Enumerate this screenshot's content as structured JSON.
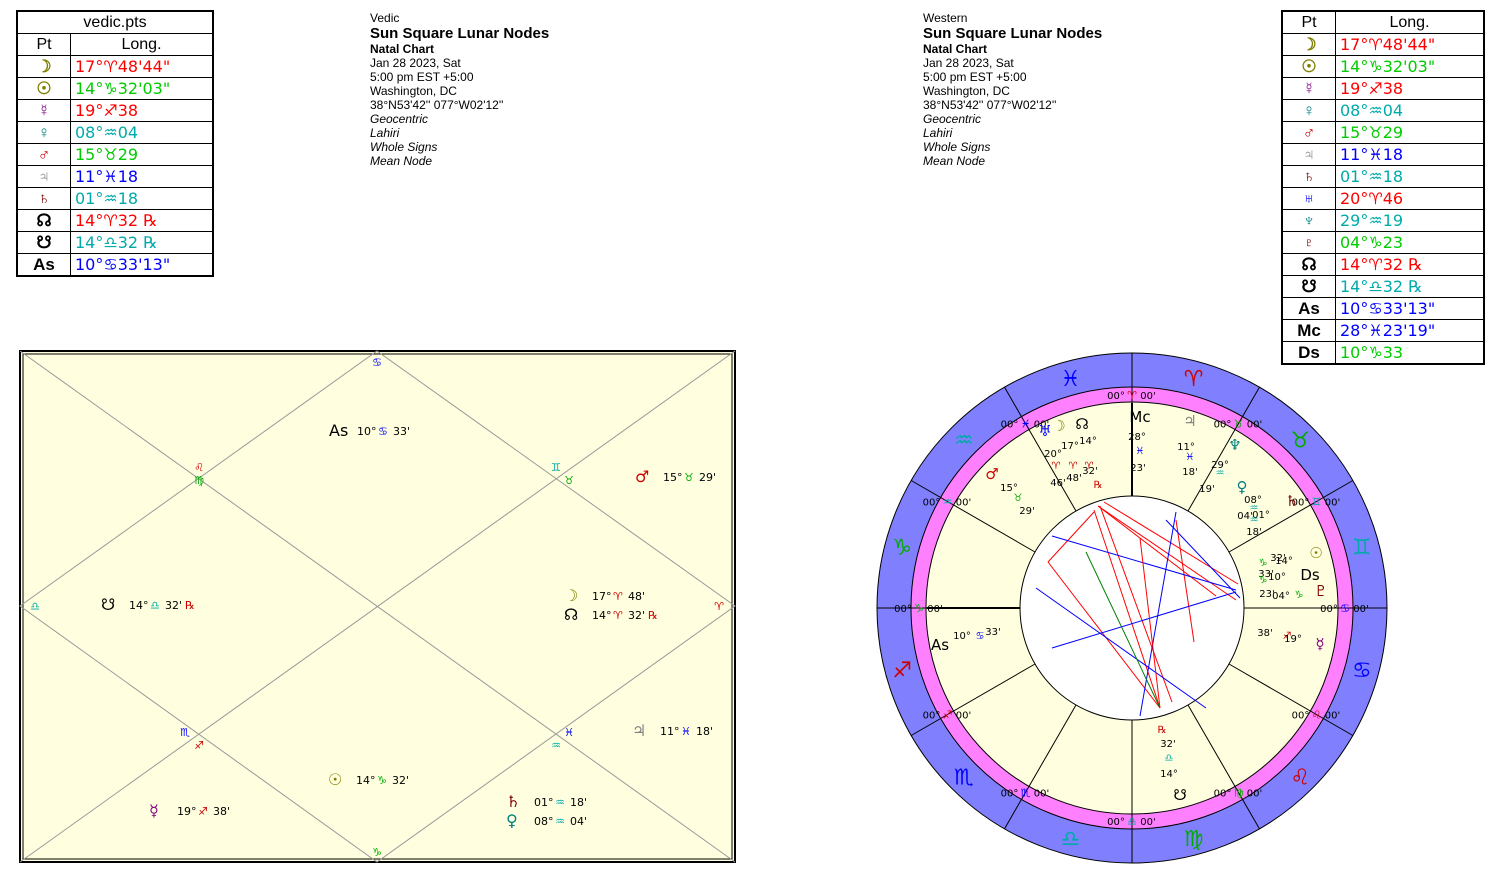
{
  "vedic_table": {
    "title": "vedic.pts",
    "col_pt": "Pt",
    "col_long": "Long.",
    "rows": [
      {
        "glyph": "☽",
        "icon": "moon-icon",
        "pos": "17°♈48'44\"",
        "color": "#ff0000",
        "gcolor": "#808000"
      },
      {
        "glyph": "☉",
        "icon": "sun-icon",
        "pos": "14°♑32'03\"",
        "color": "#00cc00",
        "gcolor": "#808000"
      },
      {
        "glyph": "☿",
        "icon": "mercury-icon",
        "pos": "19°♐38",
        "color": "#ff0000",
        "gcolor": "#800080"
      },
      {
        "glyph": "♀",
        "icon": "venus-icon",
        "pos": "08°♒04",
        "color": "#00aaaa",
        "gcolor": "#008080"
      },
      {
        "glyph": "♂",
        "icon": "mars-icon",
        "pos": "15°♉29",
        "color": "#00cc00",
        "gcolor": "#cc0000"
      },
      {
        "glyph": "♃",
        "icon": "jupiter-icon",
        "pos": "11°♓18",
        "color": "#0000ff",
        "gcolor": "#808080"
      },
      {
        "glyph": "♄",
        "icon": "saturn-icon",
        "pos": "01°♒18",
        "color": "#00aaaa",
        "gcolor": "#800000"
      },
      {
        "glyph": "☊",
        "icon": "north-node-icon",
        "pos": "14°♈32 ℞",
        "color": "#ff0000",
        "gcolor": "#000000"
      },
      {
        "glyph": "☋",
        "icon": "south-node-icon",
        "pos": "14°♎32 ℞",
        "color": "#00aaaa",
        "gcolor": "#000000"
      },
      {
        "glyph": "As",
        "icon": "ascendant-icon",
        "pos": "10°♋33'13\"",
        "color": "#0000ff",
        "gcolor": "#000000"
      }
    ]
  },
  "western_table": {
    "col_pt": "Pt",
    "col_long": "Long.",
    "rows": [
      {
        "glyph": "☽",
        "icon": "moon-icon",
        "pos": "17°♈48'44\"",
        "color": "#ff0000",
        "gcolor": "#808000"
      },
      {
        "glyph": "☉",
        "icon": "sun-icon",
        "pos": "14°♑32'03\"",
        "color": "#00cc00",
        "gcolor": "#808000"
      },
      {
        "glyph": "☿",
        "icon": "mercury-icon",
        "pos": "19°♐38",
        "color": "#ff0000",
        "gcolor": "#800080"
      },
      {
        "glyph": "♀",
        "icon": "venus-icon",
        "pos": "08°♒04",
        "color": "#00aaaa",
        "gcolor": "#008080"
      },
      {
        "glyph": "♂",
        "icon": "mars-icon",
        "pos": "15°♉29",
        "color": "#00cc00",
        "gcolor": "#cc0000"
      },
      {
        "glyph": "♃",
        "icon": "jupiter-icon",
        "pos": "11°♓18",
        "color": "#0000ff",
        "gcolor": "#808080"
      },
      {
        "glyph": "♄",
        "icon": "saturn-icon",
        "pos": "01°♒18",
        "color": "#00aaaa",
        "gcolor": "#800000"
      },
      {
        "glyph": "♅",
        "icon": "uranus-icon",
        "pos": "20°♈46",
        "color": "#ff0000",
        "gcolor": "#0000ff"
      },
      {
        "glyph": "♆",
        "icon": "neptune-icon",
        "pos": "29°♒19",
        "color": "#00aaaa",
        "gcolor": "#008080"
      },
      {
        "glyph": "♇",
        "icon": "pluto-icon",
        "pos": "04°♑23",
        "color": "#00cc00",
        "gcolor": "#800000"
      },
      {
        "glyph": "☊",
        "icon": "north-node-icon",
        "pos": "14°♈32 ℞",
        "color": "#ff0000",
        "gcolor": "#000000"
      },
      {
        "glyph": "☋",
        "icon": "south-node-icon",
        "pos": "14°♎32 ℞",
        "color": "#00aaaa",
        "gcolor": "#000000"
      },
      {
        "glyph": "As",
        "icon": "ascendant-icon",
        "pos": "10°♋33'13\"",
        "color": "#0000ff",
        "gcolor": "#000000"
      },
      {
        "glyph": "Mc",
        "icon": "midheaven-icon",
        "pos": "28°♓23'19\"",
        "color": "#0000ff",
        "gcolor": "#000000"
      },
      {
        "glyph": "Ds",
        "icon": "descendant-icon",
        "pos": "10°♑33",
        "color": "#00cc00",
        "gcolor": "#000000"
      }
    ]
  },
  "vedic_info": {
    "system": "Vedic",
    "title": "Sun Square Lunar Nodes",
    "chart_type": "Natal Chart",
    "date": "Jan 28 2023, Sat",
    "time": "5:00 pm  EST +5:00",
    "place": "Washington, DC",
    "coords": "38°N53'42'' 077°W02'12''",
    "zodiac": "Geocentric",
    "ayanamsa": "Lahiri",
    "houses": "Whole Signs",
    "node": "Mean Node"
  },
  "western_info": {
    "system": "Western",
    "title": "Sun Square Lunar Nodes",
    "chart_type": "Natal Chart",
    "date": "Jan 28 2023, Sat",
    "time": "5:00 pm  EST +5:00",
    "place": "Washington, DC",
    "coords": "38°N53'42'' 077°W02'12''",
    "zodiac": "Geocentric",
    "ayanamsa": "Lahiri",
    "houses": "Whole Signs",
    "node": "Mean Node"
  },
  "vedic_chart": {
    "house_signs": [
      {
        "text": "♋",
        "color": "#0000ff"
      },
      {
        "text": "♌",
        "color": "#cc0000"
      },
      {
        "text": "♍",
        "color": "#00aa00"
      },
      {
        "text": "♎",
        "color": "#00aaaa"
      },
      {
        "text": "♏",
        "color": "#0000ff"
      },
      {
        "text": "♐",
        "color": "#cc0000"
      },
      {
        "text": "♑",
        "color": "#00aa00"
      },
      {
        "text": "♒",
        "color": "#00aaaa"
      },
      {
        "text": "♓",
        "color": "#0000ff"
      },
      {
        "text": "♈",
        "color": "#cc0000"
      },
      {
        "text": "♉",
        "color": "#00aa00"
      },
      {
        "text": "♊",
        "color": "#00aaaa"
      }
    ],
    "planets": [
      {
        "glyph": "As",
        "deg": "10°",
        "sign": "♋",
        "min": "33'",
        "gcolor": "#000000",
        "scolor": "#0000ff",
        "retro": ""
      },
      {
        "glyph": "♂",
        "deg": "15°",
        "sign": "♉",
        "min": "29'",
        "gcolor": "#cc0000",
        "scolor": "#00aa00",
        "retro": ""
      },
      {
        "glyph": "☋",
        "deg": "14°",
        "sign": "♎",
        "min": "32'",
        "gcolor": "#000000",
        "scolor": "#00aaaa",
        "retro": "℞"
      },
      {
        "glyph": "☽",
        "deg": "17°",
        "sign": "♈",
        "min": "48'",
        "gcolor": "#808000",
        "scolor": "#cc0000",
        "retro": ""
      },
      {
        "glyph": "☊",
        "deg": "14°",
        "sign": "♈",
        "min": "32'",
        "gcolor": "#000000",
        "scolor": "#cc0000",
        "retro": "℞"
      },
      {
        "glyph": "♃",
        "deg": "11°",
        "sign": "♓",
        "min": "18'",
        "gcolor": "#808080",
        "scolor": "#0000ff",
        "retro": ""
      },
      {
        "glyph": "☉",
        "deg": "14°",
        "sign": "♑",
        "min": "32'",
        "gcolor": "#808000",
        "scolor": "#00aa00",
        "retro": ""
      },
      {
        "glyph": "☿",
        "deg": "19°",
        "sign": "♐",
        "min": "38'",
        "gcolor": "#800080",
        "scolor": "#cc0000",
        "retro": ""
      },
      {
        "glyph": "♄",
        "deg": "01°",
        "sign": "♒",
        "min": "18'",
        "gcolor": "#800000",
        "scolor": "#00aaaa",
        "retro": ""
      },
      {
        "glyph": "♀",
        "deg": "08°",
        "sign": "♒",
        "min": "04'",
        "gcolor": "#008080",
        "scolor": "#00aaaa",
        "retro": ""
      }
    ]
  },
  "western_chart": {
    "zodiac_signs": [
      {
        "text": "♈",
        "color": "#cc0000"
      },
      {
        "text": "♓",
        "color": "#0000ff"
      },
      {
        "text": "♒",
        "color": "#00aaaa"
      },
      {
        "text": "♑",
        "color": "#00aa00"
      },
      {
        "text": "♐",
        "color": "#cc0000"
      },
      {
        "text": "♏",
        "color": "#0000ff"
      },
      {
        "text": "♎",
        "color": "#00aaaa"
      },
      {
        "text": "♍",
        "color": "#00aa00"
      },
      {
        "text": "♌",
        "color": "#cc0000"
      },
      {
        "text": "♋",
        "color": "#0000ff"
      },
      {
        "text": "♊",
        "color": "#00aaaa"
      },
      {
        "text": "♉",
        "color": "#00aa00"
      }
    ],
    "cusp_label": "00° ",
    "cusp_min": " 00'",
    "ring_signs": [
      {
        "text": "♈",
        "color": "#cc0000"
      },
      {
        "text": "♓",
        "color": "#0000ff"
      },
      {
        "text": "♒",
        "color": "#00aaaa"
      },
      {
        "text": "♑",
        "color": "#00aa00"
      },
      {
        "text": "♐",
        "color": "#cc0000"
      },
      {
        "text": "♏",
        "color": "#0000ff"
      },
      {
        "text": "♎",
        "color": "#00aaaa"
      },
      {
        "text": "♍",
        "color": "#00aa00"
      },
      {
        "text": "♌",
        "color": "#cc0000"
      },
      {
        "text": "♋",
        "color": "#0000ff"
      },
      {
        "text": "♊",
        "color": "#00aaaa"
      },
      {
        "text": "♉",
        "color": "#00aa00"
      }
    ],
    "planet_labels": [
      {
        "glyph": "☽",
        "color": "#808000"
      },
      {
        "glyph": "☊",
        "color": "#000000"
      },
      {
        "glyph": "♅",
        "color": "#0000ff"
      },
      {
        "glyph": "♂",
        "color": "#cc0000"
      },
      {
        "glyph": "♃",
        "color": "#808080"
      },
      {
        "glyph": "♆",
        "color": "#008080"
      },
      {
        "glyph": "♀",
        "color": "#008080"
      },
      {
        "glyph": "♄",
        "color": "#800000"
      },
      {
        "glyph": "☉",
        "color": "#808000"
      },
      {
        "glyph": "Ds",
        "color": "#000000"
      },
      {
        "glyph": "♇",
        "color": "#800000"
      },
      {
        "glyph": "☿",
        "color": "#800080"
      },
      {
        "glyph": "As",
        "color": "#000000"
      },
      {
        "glyph": "☋",
        "color": "#000000"
      },
      {
        "glyph": "Mc",
        "color": "#000000"
      }
    ],
    "planet_text": [
      {
        "text": "20°",
        "color": "#000"
      },
      {
        "text": "17°",
        "color": "#000"
      },
      {
        "text": "14°",
        "color": "#000"
      },
      {
        "text": "♈",
        "color": "#cc0000"
      },
      {
        "text": "♈",
        "color": "#cc0000"
      },
      {
        "text": "♈",
        "color": "#cc0000"
      },
      {
        "text": "46'",
        "color": "#000"
      },
      {
        "text": "48'",
        "color": "#000"
      },
      {
        "text": "32'",
        "color": "#000"
      },
      {
        "text": "℞",
        "color": "#cc0000"
      },
      {
        "text": "15°",
        "color": "#000"
      },
      {
        "text": "♉",
        "color": "#00aa00"
      },
      {
        "text": "29'",
        "color": "#000"
      },
      {
        "text": "28°",
        "color": "#000"
      },
      {
        "text": "♓",
        "color": "#0000ff"
      },
      {
        "text": "23'",
        "color": "#000"
      },
      {
        "text": "11°",
        "color": "#000"
      },
      {
        "text": "♓",
        "color": "#0000ff"
      },
      {
        "text": "18'",
        "color": "#000"
      },
      {
        "text": "29°",
        "color": "#000"
      },
      {
        "text": "♒",
        "color": "#00aaaa"
      },
      {
        "text": "19'",
        "color": "#000"
      },
      {
        "text": "08°",
        "color": "#000"
      },
      {
        "text": "♒",
        "color": "#00aaaa"
      },
      {
        "text": "04'",
        "color": "#000"
      },
      {
        "text": "01°",
        "color": "#000"
      },
      {
        "text": "♒",
        "color": "#00aaaa"
      },
      {
        "text": "18'",
        "color": "#000"
      },
      {
        "text": "32'",
        "color": "#000"
      },
      {
        "text": "14°",
        "color": "#000"
      },
      {
        "text": "33'",
        "color": "#000"
      },
      {
        "text": "10°",
        "color": "#000"
      },
      {
        "text": "♑",
        "color": "#00aa00"
      },
      {
        "text": "♑",
        "color": "#00aa00"
      },
      {
        "text": "23'",
        "color": "#000"
      },
      {
        "text": "04°",
        "color": "#000"
      },
      {
        "text": "♑",
        "color": "#00aa00"
      },
      {
        "text": "38'",
        "color": "#000"
      },
      {
        "text": "♐",
        "color": "#cc0000"
      },
      {
        "text": "19°",
        "color": "#000"
      },
      {
        "text": "10°",
        "color": "#000"
      },
      {
        "text": "♋",
        "color": "#0000ff"
      },
      {
        "text": "33'",
        "color": "#000"
      },
      {
        "text": "℞",
        "color": "#cc0000"
      },
      {
        "text": "32'",
        "color": "#000"
      },
      {
        "text": "♎",
        "color": "#00aaaa"
      },
      {
        "text": "14°",
        "color": "#000"
      }
    ]
  }
}
